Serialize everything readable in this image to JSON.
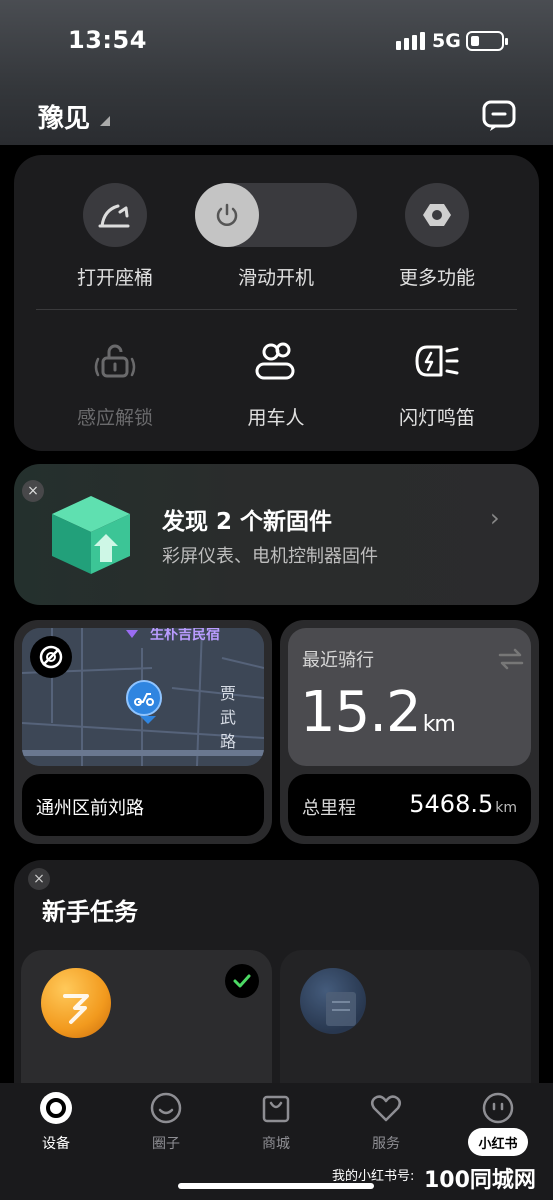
{
  "status_bar": {
    "time": "13:54",
    "network": "5G"
  },
  "header": {
    "title": "豫见"
  },
  "controls": {
    "row1": [
      {
        "label": "打开座桶"
      },
      {
        "label": "滑动开机"
      },
      {
        "label": "更多功能"
      }
    ],
    "row2": [
      {
        "label": "感应解锁"
      },
      {
        "label": "用车人"
      },
      {
        "label": "闪灯鸣笛"
      }
    ]
  },
  "firmware": {
    "title": "发现 2 个新固件",
    "subtitle": "彩屏仪表、电机控制器固件"
  },
  "map": {
    "top_label": "生朴吉民宿",
    "road_label": "贾\n武\n路",
    "address": "通州区前刘路"
  },
  "ride": {
    "label": "最近骑行",
    "value": "15.2",
    "unit": "km",
    "total_label": "总里程",
    "total_value": "5468.5",
    "total_unit": "km"
  },
  "tasks": {
    "title": "新手任务"
  },
  "tabbar": {
    "items": [
      {
        "label": "设备"
      },
      {
        "label": "圈子"
      },
      {
        "label": "商城"
      },
      {
        "label": "服务"
      },
      {
        "label": "我的"
      }
    ]
  },
  "watermark": {
    "badge": "小红书",
    "text": "我的小红书号:",
    "site": "100同城网"
  },
  "colors": {
    "background": "#000000",
    "card": "#1c1c1e",
    "accent_green": "#4cd964",
    "accent_blue": "#3a8fdc"
  }
}
